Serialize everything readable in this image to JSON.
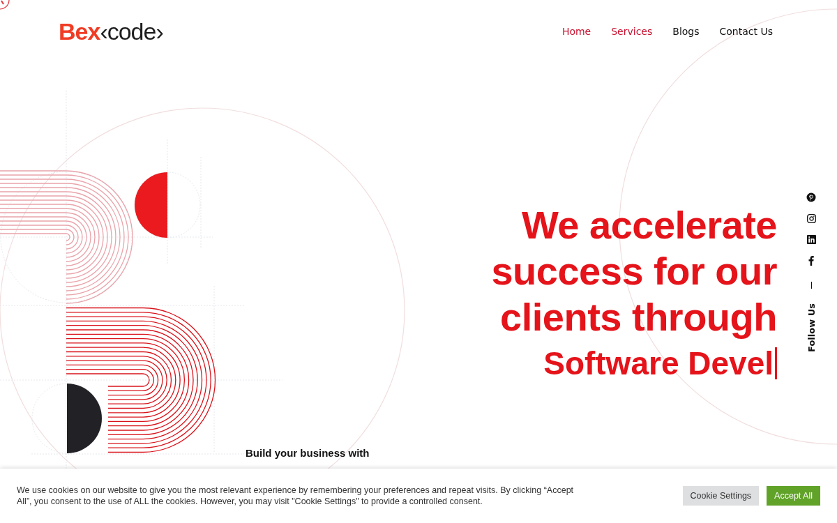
{
  "logo": {
    "brand": "Bex",
    "code": "‹code›"
  },
  "nav": [
    {
      "label": "Home",
      "selected": true
    },
    {
      "label": "Services",
      "selected": true
    },
    {
      "label": "Blogs",
      "selected": false
    },
    {
      "label": "Contact Us",
      "selected": false
    }
  ],
  "hero": {
    "headline_lines": [
      "We accelerate",
      "success for our",
      "clients through"
    ],
    "typed_text": "Software Devel"
  },
  "social": {
    "icons": [
      {
        "kind": "pinterest"
      },
      {
        "kind": "instagram"
      },
      {
        "kind": "linkedin"
      },
      {
        "kind": "facebook"
      }
    ],
    "label": "Follow Us"
  },
  "intro": {
    "text": "Build your business with"
  },
  "cookie_bar": {
    "message": "We use cookies on our website to give you the most relevant experience by remembering your preferences and repeat visits. By clicking “Accept All”, you consent to the use of ALL the cookies. However, you may visit \"Cookie Settings\" to provide a controlled consent.",
    "buttons": [
      {
        "label": "Cookie Settings",
        "kind": "secondary"
      },
      {
        "label": "Accept All",
        "kind": "primary"
      }
    ]
  }
}
